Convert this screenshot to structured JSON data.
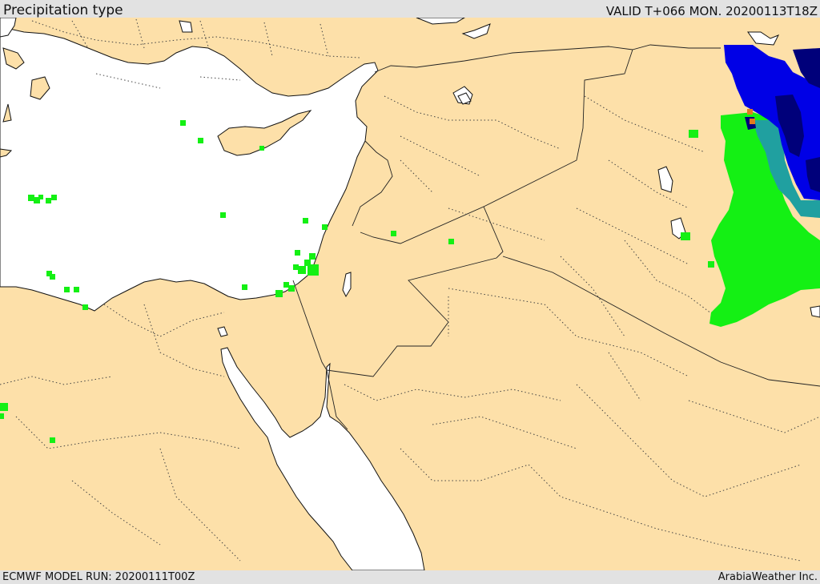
{
  "header": {
    "title": "Precipitation type",
    "valid": "VALID T+066 MON. 20200113T18Z"
  },
  "footer": {
    "model_run": "ECMWF MODEL RUN: 20200111T00Z",
    "credit": "ArabiaWeather Inc."
  },
  "colors": {
    "land": "#fde0a9",
    "sea": "#ffffff",
    "rain": "#14f014",
    "snow": "#0000e6",
    "heavy_snow": "#00007a",
    "mixed": "#20a0a0",
    "freezing_rain": "#e07a20"
  }
}
